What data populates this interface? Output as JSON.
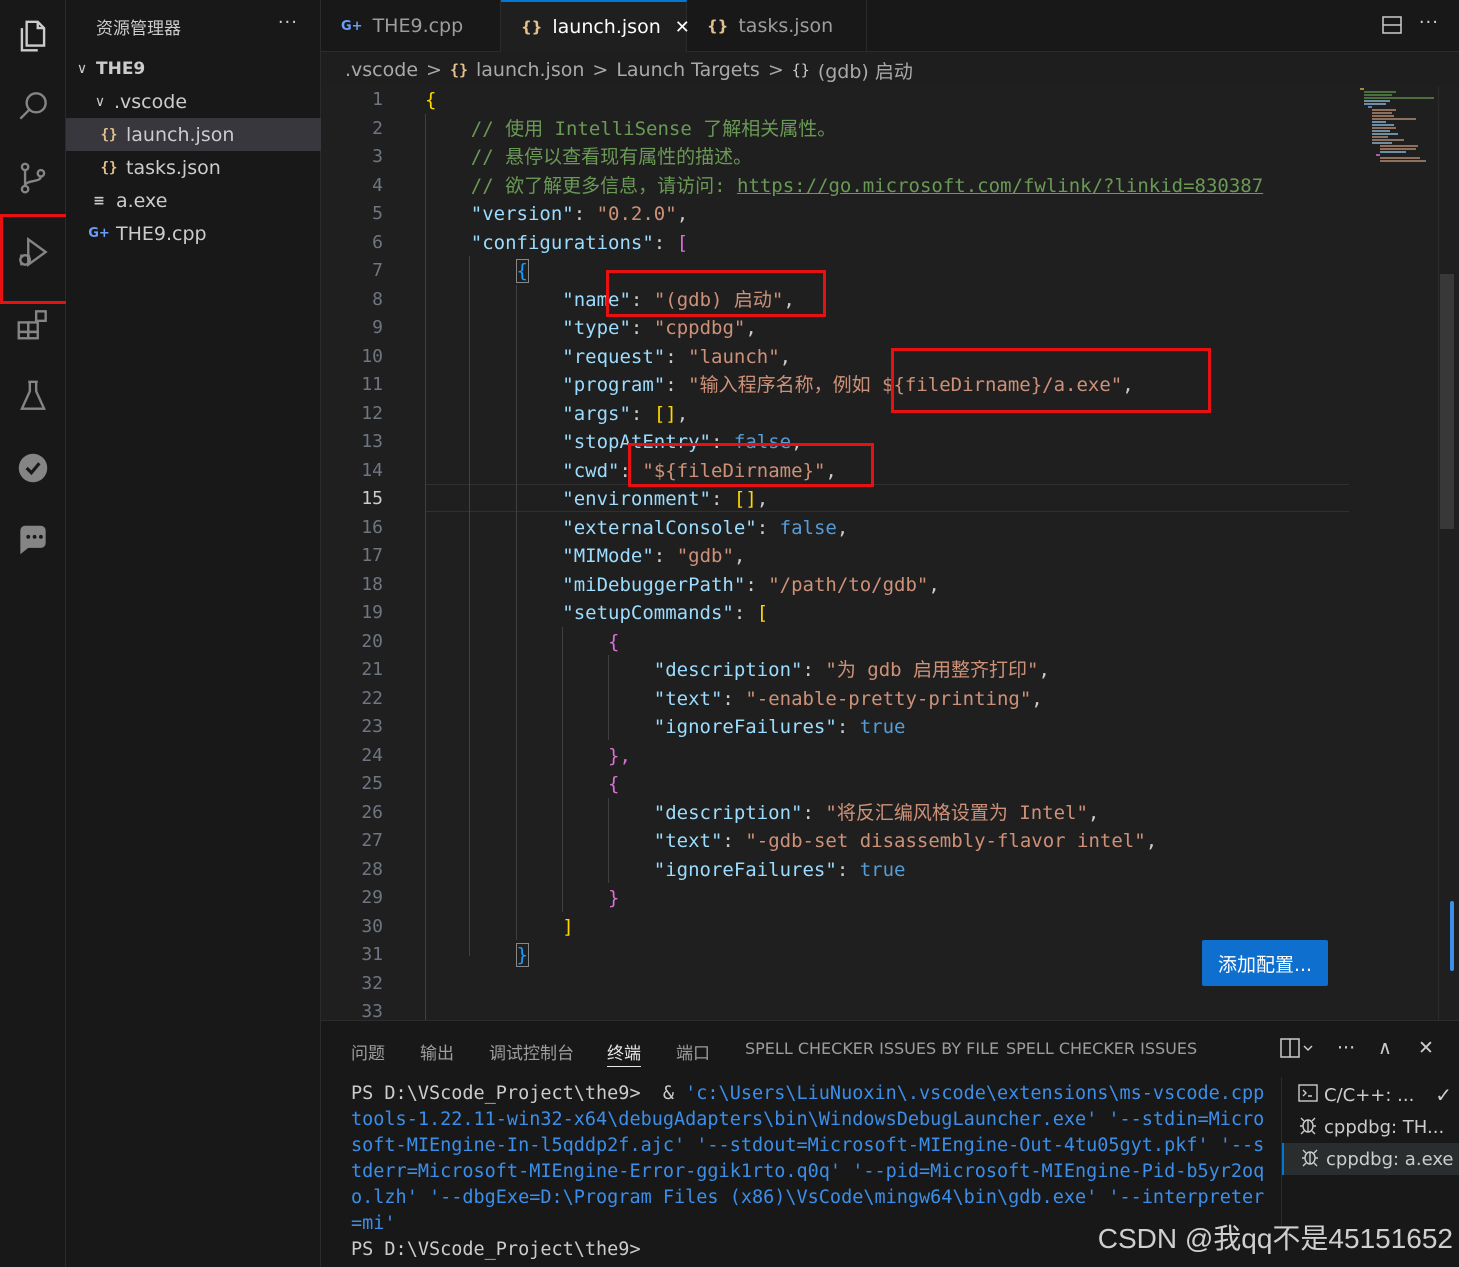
{
  "sidebar": {
    "title": "资源管理器",
    "more": "···",
    "tree": [
      {
        "chev": "∨",
        "label": "THE9"
      },
      {
        "chev": "∨",
        "label": ".vscode"
      },
      {
        "icon": "{}",
        "label": "launch.json"
      },
      {
        "icon": "{}",
        "label": "tasks.json"
      },
      {
        "icon": "≡",
        "label": "a.exe"
      },
      {
        "icon": "G+",
        "label": "THE9.cpp"
      }
    ]
  },
  "tabs": [
    {
      "icon": "G+",
      "label": "THE9.cpp"
    },
    {
      "icon": "{}",
      "label": "launch.json",
      "close": "✕"
    },
    {
      "icon": "{}",
      "label": "tasks.json"
    }
  ],
  "tab_more": "···",
  "breadcrumb": {
    "items": [
      ".vscode",
      "launch.json",
      "Launch Targets",
      "(gdb) 启动"
    ],
    "icon_json": "{}",
    "icon_obj": "{}",
    "sep": ">"
  },
  "editor": {
    "line_numbers": [
      "1",
      "2",
      "3",
      "4",
      "5",
      "6",
      "7",
      "8",
      "9",
      "10",
      "11",
      "12",
      "13",
      "14",
      "15",
      "16",
      "17",
      "18",
      "19",
      "20",
      "21",
      "22",
      "23",
      "24",
      "25",
      "26",
      "27",
      "28",
      "29",
      "30",
      "31",
      "32",
      "33"
    ],
    "current_line": 15,
    "lines": {
      "l1": "{",
      "l2": "// 使用 IntelliSense 了解相关属性。",
      "l3": "// 悬停以查看现有属性的描述。",
      "l4a": "// 欲了解更多信息，请访问: ",
      "l4b": "https://go.microsoft.com/fwlink/?linkid=830387",
      "version_key": "\"version\"",
      "version_val": "\"0.2.0\"",
      "configurations_key": "\"configurations\"",
      "open_bracket": "[",
      "open_brace": "{",
      "name_key": "\"name\"",
      "name_val": "\"(gdb) 启动\"",
      "type_key": "\"type\"",
      "type_val": "\"cppdbg\"",
      "request_key": "\"request\"",
      "request_val": "\"launch\"",
      "program_key": "\"program\"",
      "program_val": "\"输入程序名称，例如 ${fileDirname}/a.exe\"",
      "args_key": "\"args\"",
      "args_val": "[]",
      "stop_key": "\"stopAtEntry\"",
      "stop_val": "false",
      "cwd_key": "\"cwd\"",
      "cwd_val": "\"${fileDirname}\"",
      "env_key": "\"environment\"",
      "env_val": "[]",
      "ext_key": "\"externalConsole\"",
      "ext_val": "false",
      "mimode_key": "\"MIMode\"",
      "mimode_val": "\"gdb\"",
      "midbg_key": "\"miDebuggerPath\"",
      "midbg_val": "\"/path/to/gdb\"",
      "setup_key": "\"setupCommands\"",
      "desc_key": "\"description\"",
      "desc1_val": "\"为 gdb 启用整齐打印\"",
      "text_key": "\"text\"",
      "text1_val": "\"-enable-pretty-printing\"",
      "ignore_key": "\"ignoreFailures\"",
      "true_val": "true",
      "close_brace_comma": "},",
      "desc2_val": "\"将反汇编风格设置为 Intel\"",
      "text2_val": "\"-gdb-set disassembly-flavor intel\"",
      "close_brace": "}",
      "close_bracket": "]"
    },
    "add_config_button": "添加配置..."
  },
  "panel": {
    "tabs": [
      "问题",
      "输出",
      "调试控制台",
      "终端",
      "端口",
      "SPELL CHECKER ISSUES BY FILE",
      "SPELL CHECKER ISSUES"
    ],
    "active_tab": "终端",
    "actions": {
      "more": "···",
      "maximize": "∧",
      "close": "✕"
    },
    "terminal_lines": {
      "t1a": "PS D:\\VScode_Project\\the9>  & ",
      "t1b": "'c:\\Users\\LiuNuoxin\\.vscode\\extensions\\ms-vscode.cpp",
      "t2": "tools-1.22.11-win32-x64\\debugAdapters\\bin\\WindowsDebugLauncher.exe' '--stdin=Micro",
      "t3": "soft-MIEngine-In-l5qddp2f.ajc' '--stdout=Microsoft-MIEngine-Out-4tu05gyt.pkf' '--s",
      "t4": "tderr=Microsoft-MIEngine-Error-ggik1rto.q0q' '--pid=Microsoft-MIEngine-Pid-b5yr2oq",
      "t5": "o.lzh' '--dbgExe=D:\\Program Files (x86)\\VsCode\\mingw64\\bin\\gdb.exe' '--interpreter",
      "t6": "=mi'",
      "t7": "PS D:\\VScode_Project\\the9>"
    },
    "terminal_list": [
      {
        "label": "C/C++: ..."
      },
      {
        "label": "cppdbg: TH..."
      },
      {
        "label": "cppdbg: a.exe"
      }
    ],
    "check": "✓"
  },
  "watermark": "CSDN @我qq不是45151652",
  "colors": {
    "accent": "#0078d4",
    "annotation": "#e81010",
    "button": "#0e6fcf"
  }
}
